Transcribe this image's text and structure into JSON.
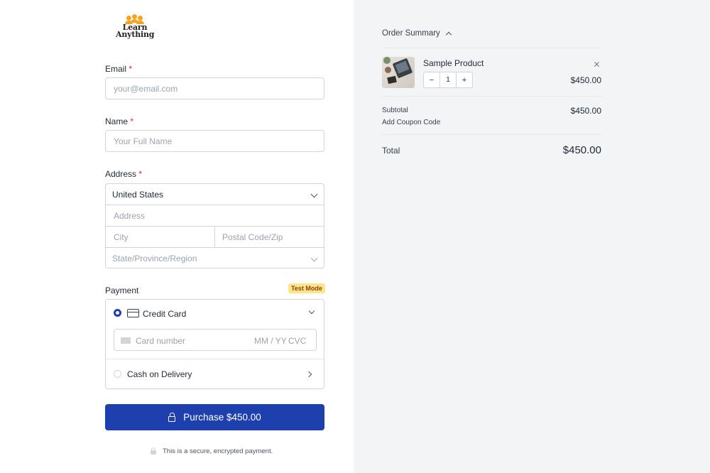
{
  "logo": {
    "line1": "Learn",
    "line2": "Anything"
  },
  "form": {
    "email": {
      "label": "Email",
      "required": "*",
      "placeholder": "your@email.com"
    },
    "name": {
      "label": "Name",
      "required": "*",
      "placeholder": "Your Full Name"
    },
    "address": {
      "label": "Address",
      "required": "*",
      "country": "United States",
      "address_placeholder": "Address",
      "city_placeholder": "City",
      "postal_placeholder": "Postal Code/Zip",
      "state_placeholder": "State/Province/Region"
    }
  },
  "payment": {
    "label": "Payment",
    "badge": "Test Mode",
    "credit_card_label": "Credit Card",
    "card_number_placeholder": "Card number",
    "expiry_placeholder": "MM / YY",
    "cvc_placeholder": "CVC",
    "cod_label": "Cash on Delivery",
    "purchase_label": "Purchase $450.00",
    "secure_note": "This is a secure, encrypted payment."
  },
  "summary": {
    "title": "Order Summary",
    "product_name": "Sample Product",
    "quantity": "1",
    "minus": "−",
    "plus": "+",
    "line_price": "$450.00",
    "subtotal_label": "Subtotal",
    "subtotal_value": "$450.00",
    "coupon_label": "Add Coupon Code",
    "total_label": "Total",
    "total_value": "$450.00"
  },
  "colors": {
    "accent": "#1e40af",
    "required": "#dc2626",
    "badge_bg": "#fde68a",
    "panel_bg": "#f3f4f6"
  }
}
